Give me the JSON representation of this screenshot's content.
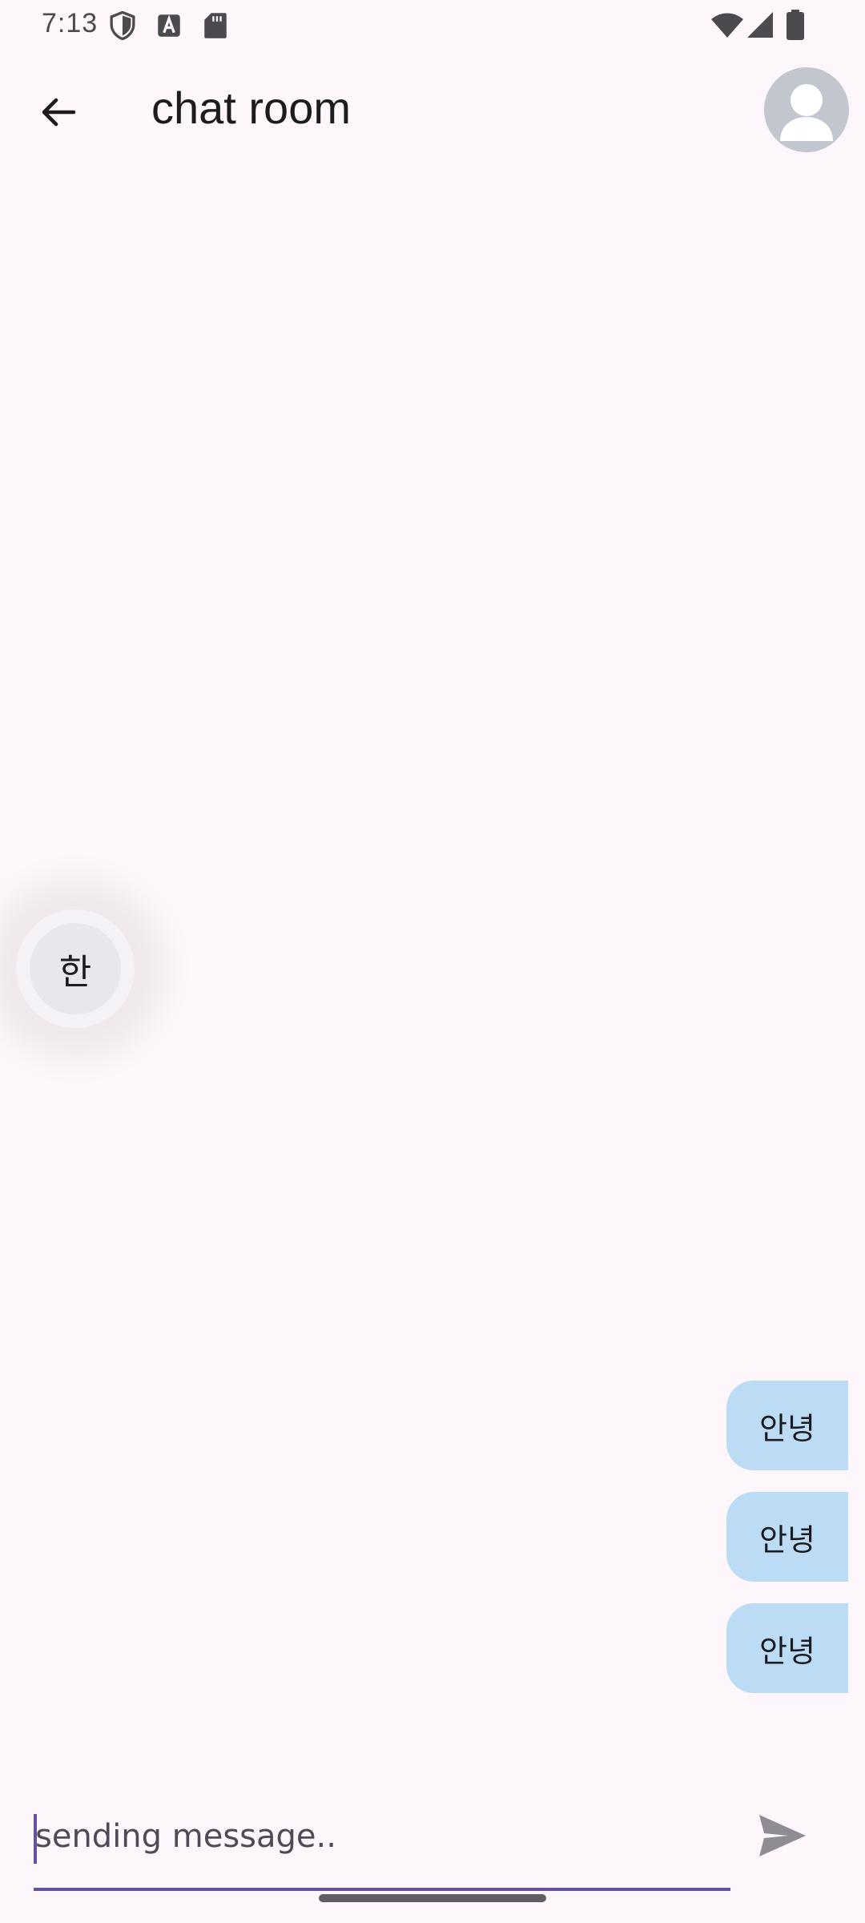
{
  "status_bar": {
    "time": "7:13",
    "left_icons": [
      "shield-icon",
      "a-badge-icon",
      "sd-card-icon"
    ],
    "right_icons": [
      "wifi-icon",
      "signal-icon",
      "battery-icon"
    ]
  },
  "app_bar": {
    "title": "chat room",
    "back_icon": "arrow-back-icon",
    "avatar_icon": "person-icon"
  },
  "messages": [
    {
      "text": "안녕",
      "sent": true
    },
    {
      "text": "안녕",
      "sent": true
    },
    {
      "text": "안녕",
      "sent": true
    }
  ],
  "floating_ime_button": {
    "label": "한"
  },
  "composer": {
    "placeholder": "sending message..",
    "value": "",
    "send_icon": "send-icon"
  },
  "colors": {
    "background": "#fdf7fc",
    "bubble": "#bcdcf6",
    "accent": "#6750a4",
    "avatar": "#c1c6cf"
  }
}
